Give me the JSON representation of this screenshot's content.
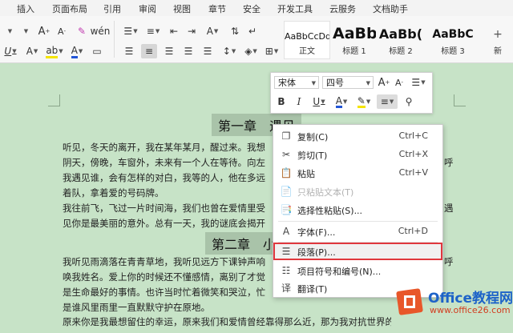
{
  "menubar": {
    "tabs": [
      "插入",
      "页面布局",
      "引用",
      "审阅",
      "视图",
      "章节",
      "安全",
      "开发工具",
      "云服务",
      "文档助手"
    ]
  },
  "ribbon": {
    "styles": [
      {
        "sample": "AaBbCcDd",
        "name": "正文"
      },
      {
        "sample": "AaBb",
        "name": "标题 1"
      },
      {
        "sample": "AaBb(",
        "name": "标题 2"
      },
      {
        "sample": "AaBbC",
        "name": "标题 3"
      },
      {
        "sample": "",
        "name": "新"
      }
    ],
    "font_color": "#2255d6",
    "highlight_color": "#f5e400"
  },
  "document": {
    "heading1": "第一章　遇见",
    "heading2": "第二章　小",
    "paragraphs1": [
      "听见，冬天的离开，我在某年某月，醒过来。我想",
      "阴天，傍晚，车窗外，未来有一个人在等待。向左",
      "我遇见谁，会有怎样的对白，我等的人，他在多远",
      "着队，拿着爱的号码牌。",
      "我往前飞，飞过一片时间海，我们也曾在爱情里受",
      "见你是最美丽的意外。总有一天，我的谜底会揭开"
    ],
    "paragraphs1_right": [
      "呼",
      "遇"
    ],
    "paragraphs2": [
      "我听见雨滴落在青青草地，我听见远方下课钟声响",
      "唤我姓名。爱上你的时候还不懂感情，离别了才觉",
      "是生命最好的事情。也许当时忙着微笑和哭泣，忙",
      "是谁风里雨里一直默默守护在原地。",
      "原来你是我最想留住的幸运，原来我们和爱情曾经靠得那么近，那为我对抗世界的决定，那"
    ],
    "paragraphs2_right": [
      "呼"
    ]
  },
  "mini_toolbar": {
    "font_name": "宋体",
    "font_size": "四号"
  },
  "context_menu": {
    "items": [
      {
        "icon": "copy-icon",
        "label": "复制(C)",
        "shortcut": "Ctrl+C",
        "disabled": false
      },
      {
        "icon": "cut-icon",
        "label": "剪切(T)",
        "shortcut": "Ctrl+X",
        "disabled": false
      },
      {
        "icon": "paste-icon",
        "label": "粘贴",
        "shortcut": "Ctrl+V",
        "disabled": false
      },
      {
        "icon": "paste-text-icon",
        "label": "只粘贴文本(T)",
        "shortcut": "",
        "disabled": true
      },
      {
        "icon": "paste-special-icon",
        "label": "选择性粘贴(S)...",
        "shortcut": "",
        "disabled": false
      },
      {
        "icon": "font-icon",
        "label": "字体(F)...",
        "shortcut": "Ctrl+D",
        "disabled": false
      },
      {
        "icon": "paragraph-icon",
        "label": "段落(P)...",
        "shortcut": "",
        "disabled": false,
        "highlight": true
      },
      {
        "icon": "bullets-icon",
        "label": "项目符号和编号(N)...",
        "shortcut": "",
        "disabled": false
      },
      {
        "icon": "translate-icon",
        "label": "翻译(T)",
        "shortcut": "",
        "disabled": false
      }
    ]
  },
  "watermark": {
    "title": "Office教程网",
    "url": "www.office26.com"
  }
}
